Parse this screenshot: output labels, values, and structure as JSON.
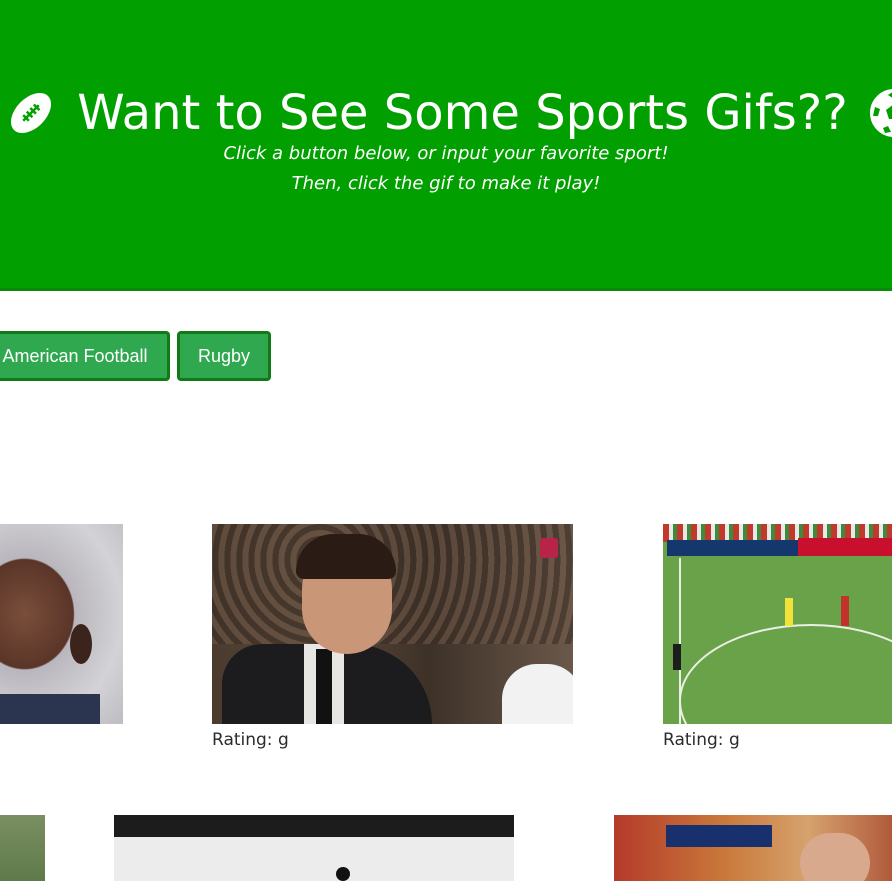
{
  "header": {
    "title": "Want to See Some Sports Gifs??",
    "subtitle_line1": "Click a button below, or input your favorite sport!",
    "subtitle_line2": "Then, click the gif to make it play!",
    "left_icon": "football-icon",
    "right_icon": "soccer-ball-icon",
    "background_color": "#019f00"
  },
  "buttons": [
    {
      "label": "American Football"
    },
    {
      "label": "Rugby"
    }
  ],
  "gifs": {
    "row1": [
      {
        "rating": ""
      },
      {
        "rating": "Rating: g"
      },
      {
        "rating": "Rating: g"
      }
    ]
  },
  "colors": {
    "button_bg": "#2fa84f",
    "button_border": "#0f7a16"
  }
}
